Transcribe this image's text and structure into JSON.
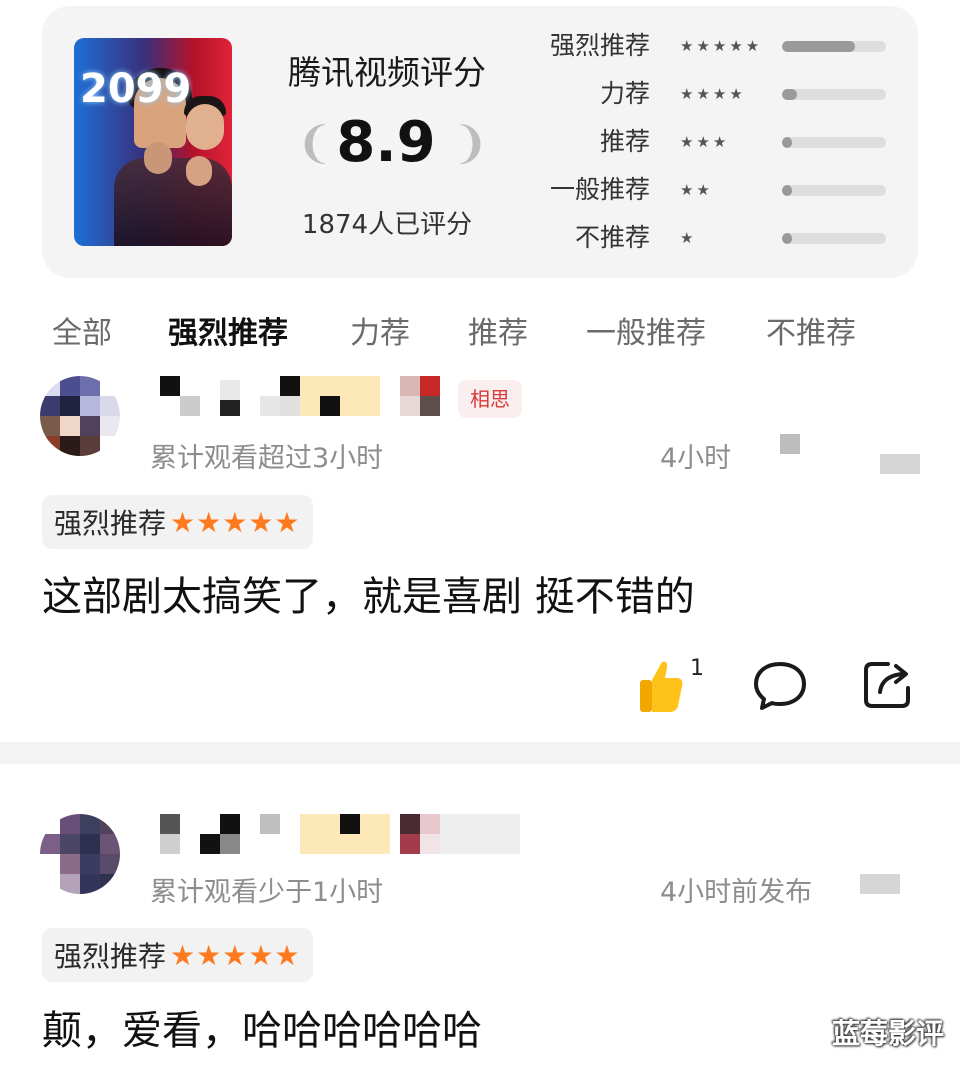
{
  "rating_card": {
    "title": "腾讯视频评分",
    "score": "8.9",
    "raters": "1874人已评分",
    "poster_text": "2099",
    "distribution": [
      {
        "label": "强烈推荐",
        "stars": "★★★★★",
        "fraction": 0.7
      },
      {
        "label": "力荐",
        "stars": "★★★★",
        "fraction": 0.14
      },
      {
        "label": "推荐",
        "stars": "★★★",
        "fraction": 0.1
      },
      {
        "label": "一般推荐",
        "stars": "★★",
        "fraction": 0.1
      },
      {
        "label": "不推荐",
        "stars": "★",
        "fraction": 0.1
      }
    ]
  },
  "tabs": [
    {
      "label": "全部",
      "active": false
    },
    {
      "label": "强烈推荐",
      "active": true
    },
    {
      "label": "力荐",
      "active": false
    },
    {
      "label": "推荐",
      "active": false
    },
    {
      "label": "一般推荐",
      "active": false
    },
    {
      "label": "不推荐",
      "active": false
    }
  ],
  "reviews": [
    {
      "tag": "相思",
      "watch_time": "累计观看超过3小时",
      "posted": "4小时",
      "recommend_label": "强烈推荐",
      "recommend_stars": "★★★★★",
      "text": "这部剧太搞笑了，就是喜剧 挺不错的",
      "likes": "1"
    },
    {
      "watch_time": "累计观看少于1小时",
      "posted": "4小时前发布",
      "recommend_label": "强烈推荐",
      "recommend_stars": "★★★★★",
      "text": "颠，爱看，哈哈哈哈哈哈"
    }
  ],
  "watermark": "蓝莓影评",
  "colors": {
    "accent_star": "#ff7a1e",
    "tag_text": "#d63a3a",
    "like_yellow": "#ffc21a"
  }
}
